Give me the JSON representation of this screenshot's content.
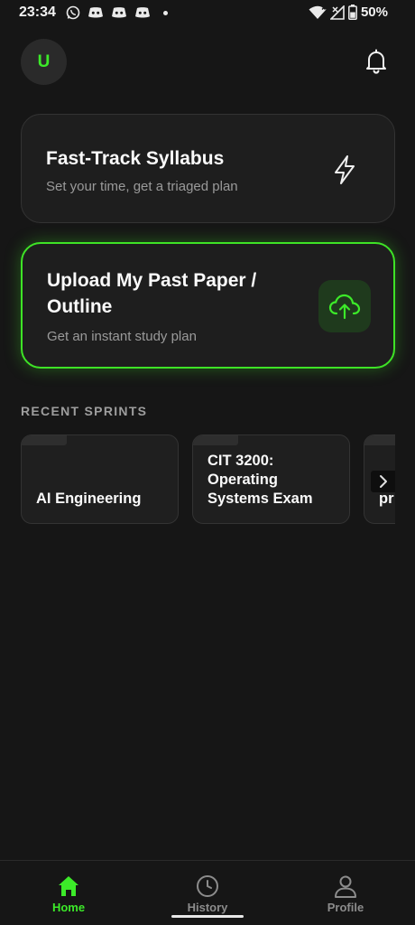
{
  "status_bar": {
    "time": "23:34",
    "battery": "50%",
    "left_icons": [
      "whatsapp-icon",
      "discord-icon",
      "discord-icon",
      "discord-icon",
      "dot-icon"
    ],
    "right_icons": [
      "wifi-icon",
      "signal-icon",
      "battery-icon"
    ]
  },
  "header": {
    "avatar_initial": "U",
    "notification_icon": "bell-icon"
  },
  "cards": {
    "fast_track": {
      "title": "Fast-Track Syllabus",
      "subtitle": "Set your time, get a triaged plan",
      "icon": "lightning-icon"
    },
    "upload": {
      "title": "Upload My Past Paper / Outline",
      "subtitle": "Get an instant study plan",
      "icon": "cloud-upload-icon"
    }
  },
  "recent_sprints": {
    "title": "RECENT SPRINTS",
    "items": [
      {
        "label": "AI Engineering"
      },
      {
        "label": "CIT 3200: Operating Systems Exam"
      },
      {
        "label": "pr"
      }
    ]
  },
  "bottom_nav": {
    "items": [
      {
        "label": "Home",
        "icon": "home-icon",
        "active": true
      },
      {
        "label": "History",
        "icon": "clock-icon",
        "active": false
      },
      {
        "label": "Profile",
        "icon": "person-icon",
        "active": false
      }
    ]
  },
  "colors": {
    "accent": "#3cea29",
    "background": "#161616",
    "card": "#1e1e1e"
  }
}
